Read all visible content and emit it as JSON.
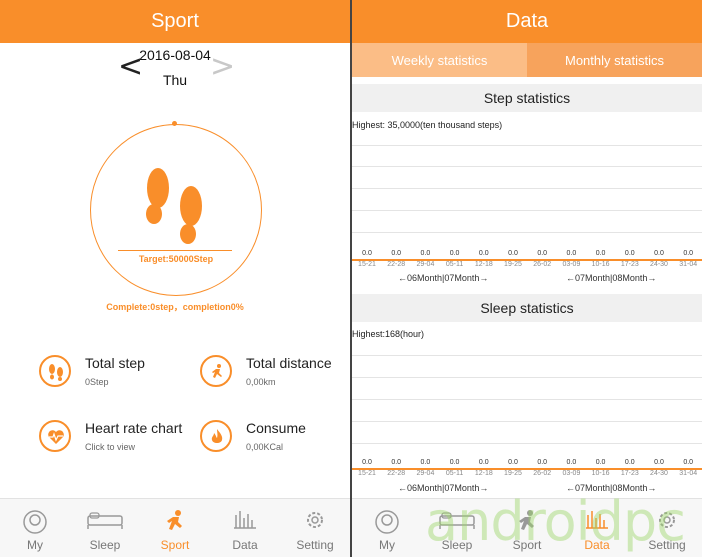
{
  "sport": {
    "title": "Sport",
    "date": "2016-08-04",
    "day": "Thu",
    "prev_arrow": "<",
    "next_arrow": ">",
    "target": "Target:50000Step",
    "complete": "Complete:0step，completion0%",
    "stats": {
      "total_step": {
        "title": "Total step",
        "sub": "0Step"
      },
      "total_distance": {
        "title": "Total distance",
        "sub": "0,00km"
      },
      "heart_rate": {
        "title": "Heart rate chart",
        "sub": "Click to view"
      },
      "consume": {
        "title": "Consume",
        "sub": "0,00KCal"
      }
    }
  },
  "data": {
    "title": "Data",
    "tabs": {
      "weekly": "Weekly statistics",
      "monthly": "Monthly statistics"
    },
    "step": {
      "title": "Step statistics",
      "highest": "Highest: 35,0000(ten thousand steps)"
    },
    "sleep": {
      "title": "Sleep statistics",
      "highest": "Highest:168(hour)"
    },
    "month_labels": [
      "←06Month|07Month→",
      "←07Month|08Month→"
    ]
  },
  "left_nav": [
    {
      "label": "My",
      "icon": "my-icon"
    },
    {
      "label": "Sleep",
      "icon": "sleep-icon"
    },
    {
      "label": "Sport",
      "icon": "sport-icon"
    },
    {
      "label": "Data",
      "icon": "data-icon"
    },
    {
      "label": "Setting",
      "icon": "setting-icon"
    }
  ],
  "right_nav": [
    {
      "label": "My",
      "icon": "my-icon"
    },
    {
      "label": "Sleep",
      "icon": "sleep-icon"
    },
    {
      "label": "Sport",
      "icon": "sport-icon"
    },
    {
      "label": "Data",
      "icon": "data-icon"
    },
    {
      "label": "Setting",
      "icon": "setting-icon"
    }
  ],
  "chart_data": [
    {
      "type": "bar",
      "title": "Step statistics",
      "categories": [
        "15-21",
        "22-28",
        "29-04",
        "05-11",
        "12-18",
        "19-25",
        "26-02",
        "03-09",
        "10-16",
        "17-23",
        "24-30",
        "31-04"
      ],
      "values": [
        0.0,
        0.0,
        0.0,
        0.0,
        0.0,
        0.0,
        0.0,
        0.0,
        0.0,
        0.0,
        0.0,
        0.0
      ],
      "value_labels": [
        "0.0",
        "0.0",
        "0.0",
        "0.0",
        "0.0",
        "0.0",
        "0.0",
        "0.0",
        "0.0",
        "0.0",
        "0.0",
        "0.0"
      ],
      "xlabel": "",
      "ylabel": ""
    },
    {
      "type": "bar",
      "title": "Sleep statistics",
      "categories": [
        "15-21",
        "22-28",
        "29-04",
        "05-11",
        "12-18",
        "19-25",
        "26-02",
        "03-09",
        "10-16",
        "17-23",
        "24-30",
        "31-04"
      ],
      "values": [
        0.0,
        0.0,
        0.0,
        0.0,
        0.0,
        0.0,
        0.0,
        0.0,
        0.0,
        0.0,
        0.0,
        0.0
      ],
      "value_labels": [
        "0.0",
        "0.0",
        "0.0",
        "0.0",
        "0.0",
        "0.0",
        "0.0",
        "0.0",
        "0.0",
        "0.0",
        "0.0",
        "0.0"
      ],
      "xlabel": "",
      "ylabel": ""
    }
  ],
  "colors": {
    "accent": "#f98e2a",
    "tab_light": "#fbbd86",
    "tab_dark": "#f7a35c"
  },
  "watermark": "androidpc"
}
